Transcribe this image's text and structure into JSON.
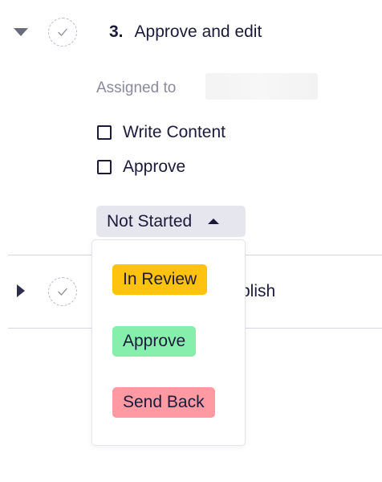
{
  "step": {
    "number": "3.",
    "title": "Approve and edit",
    "assigned_label": "Assigned to",
    "tasks": [
      {
        "label": "Write Content",
        "checked": false
      },
      {
        "label": "Approve",
        "checked": false
      }
    ],
    "status_label": "Not Started"
  },
  "next_step": {
    "visible_text": "blish"
  },
  "status_menu": {
    "options": [
      {
        "label": "In Review",
        "color": "#ffc20e"
      },
      {
        "label": "Approve",
        "color": "#86efac"
      },
      {
        "label": "Send Back",
        "color": "#ff9aa2"
      }
    ]
  },
  "colors": {
    "text": "#1b1a3a",
    "muted": "#8a8a9c",
    "status_bg": "#e6e6ef",
    "divider": "#d6d6de"
  },
  "icons": {
    "collapse": "caret-down-icon",
    "expand": "caret-right-icon",
    "complete": "check-icon",
    "dropdown": "caret-up-icon"
  }
}
